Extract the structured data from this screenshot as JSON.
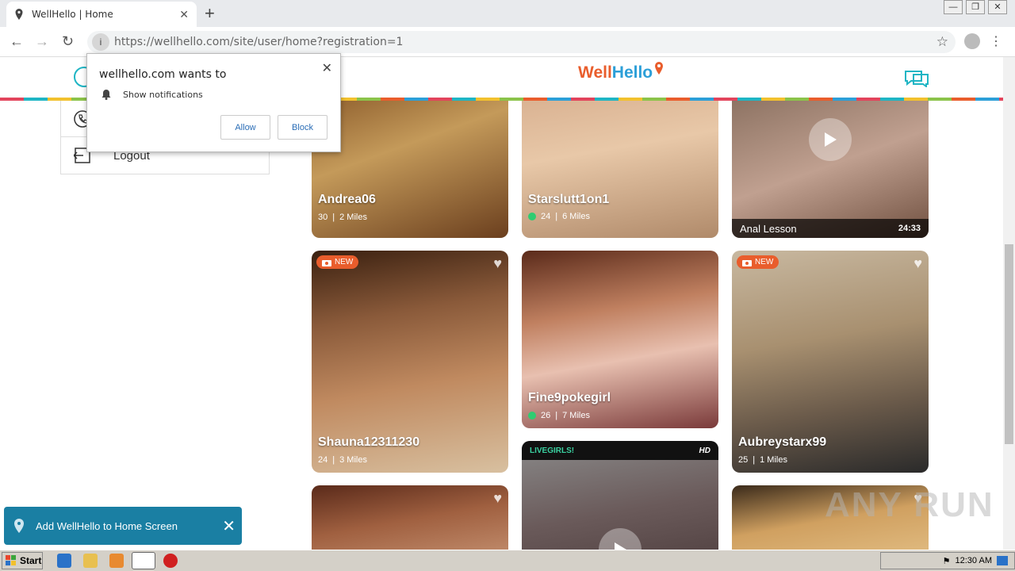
{
  "browser": {
    "tab_title": "WellHello | Home",
    "url": "https://wellhello.com/site/user/home?registration=1"
  },
  "site": {
    "logo_part1": "Well",
    "logo_part2": "Hello"
  },
  "side_menu": {
    "logout_label": "Logout"
  },
  "notification_prompt": {
    "heading": "wellhello.com wants to",
    "permission": "Show notifications",
    "allow_label": "Allow",
    "block_label": "Block"
  },
  "profiles": [
    {
      "name": "Andrea06",
      "age": "30",
      "distance": "2 Miles"
    },
    {
      "name": "Starslutt1on1",
      "age": "24",
      "distance": "6 Miles",
      "online": true
    },
    {
      "name": "Anal Lesson",
      "duration": "24:33",
      "type": "video"
    },
    {
      "name": "Shauna12311230",
      "age": "24",
      "distance": "3 Miles",
      "badge": "NEW"
    },
    {
      "name": "Fine9pokegirl",
      "age": "26",
      "distance": "7 Miles",
      "online": true
    },
    {
      "name": "Aubreystarx99",
      "age": "25",
      "distance": "1 Miles",
      "badge": "NEW"
    }
  ],
  "live_card": {
    "label": "LIVEGIRLS!",
    "quality": "HD"
  },
  "add_to_home": {
    "label": "Add WellHello to Home Screen"
  },
  "taskbar": {
    "start_label": "Start",
    "clock": "12:30 AM"
  },
  "watermark": "ANY RUN",
  "colors": {
    "brand_orange": "#e95d2c",
    "brand_blue": "#2c9fd8",
    "online_green": "#2ecc71",
    "banner_blue": "#1a7fa3"
  }
}
